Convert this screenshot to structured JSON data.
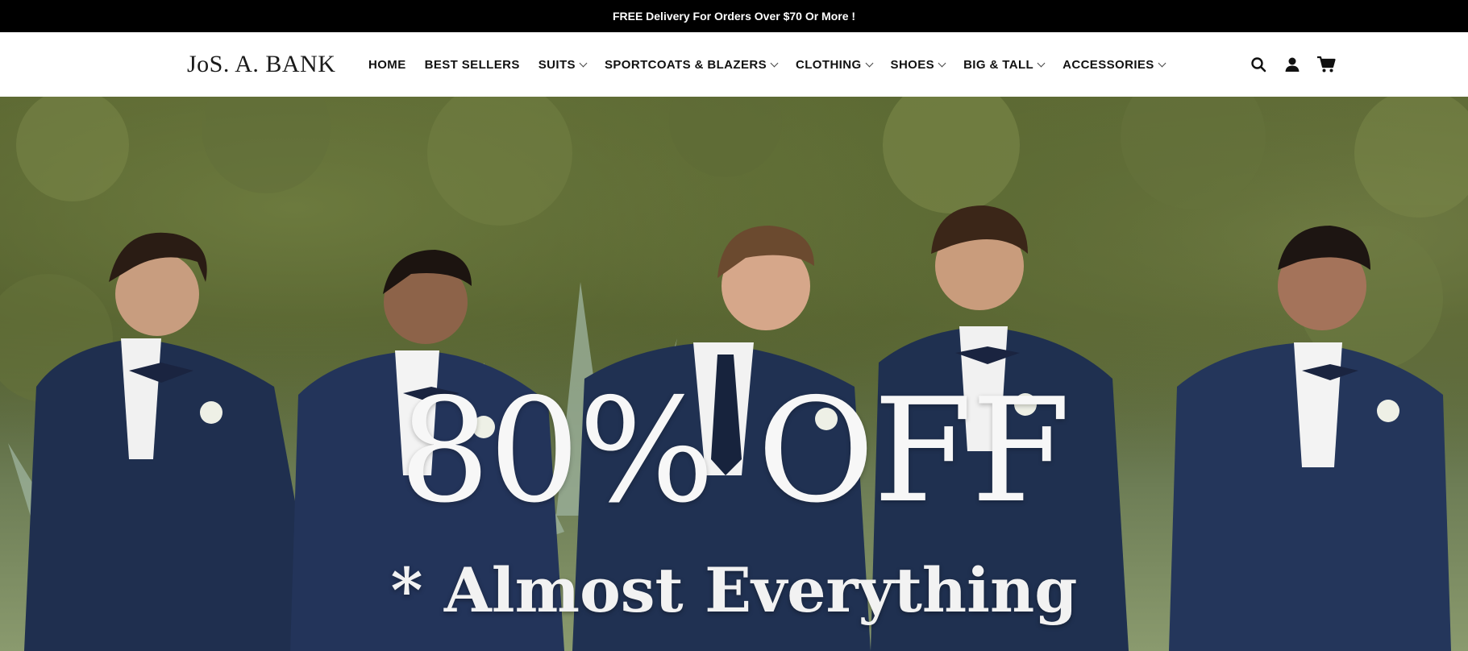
{
  "announcement": {
    "text": "FREE Delivery For Orders Over $70 Or More !"
  },
  "header": {
    "logo_text": "JoS. A. BANK",
    "nav": [
      {
        "label": "HOME",
        "has_dropdown": false
      },
      {
        "label": "BEST SELLERS",
        "has_dropdown": false
      },
      {
        "label": "SUITS",
        "has_dropdown": true
      },
      {
        "label": "SPORTCOATS & BLAZERS",
        "has_dropdown": true
      },
      {
        "label": "CLOTHING",
        "has_dropdown": true
      },
      {
        "label": "SHOES",
        "has_dropdown": true
      },
      {
        "label": "BIG & TALL",
        "has_dropdown": true
      },
      {
        "label": "ACCESSORIES",
        "has_dropdown": true
      }
    ],
    "icons": [
      "search-icon",
      "account-icon",
      "cart-icon"
    ]
  },
  "hero": {
    "headline": "80% OFF",
    "subheadline": "* Almost Everything"
  },
  "colors": {
    "announcement_bg": "#000000",
    "header_bg": "#ffffff",
    "suit_navy": "#1f2f4f",
    "foliage_green": "#56612e"
  }
}
